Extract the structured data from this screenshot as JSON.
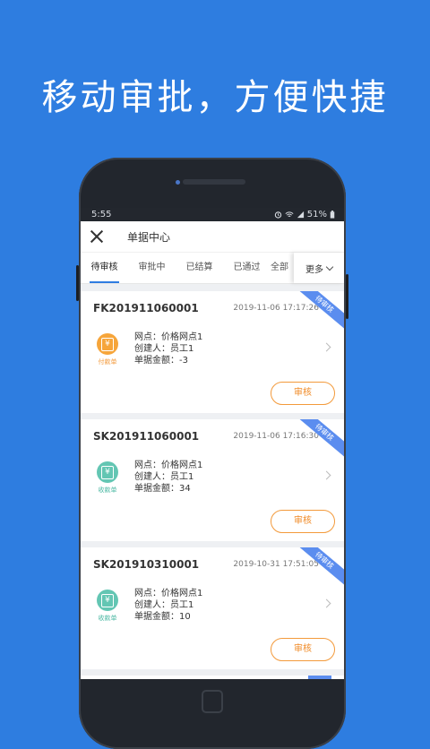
{
  "headline": "移动审批，方便快捷",
  "status_bar": {
    "time": "5:55",
    "battery": "51%",
    "icons": [
      "alarm-icon",
      "wifi-icon",
      "signal-icon",
      "battery-icon"
    ]
  },
  "nav": {
    "title": "单据中心",
    "close_icon": "close-icon"
  },
  "tabs": [
    {
      "label": "待审核",
      "active": true
    },
    {
      "label": "审批中",
      "active": false
    },
    {
      "label": "已结算",
      "active": false
    },
    {
      "label": "已通过",
      "active": false
    },
    {
      "label": "全部",
      "active": false
    }
  ],
  "more_label": "更多",
  "cards": [
    {
      "code": "FK201911060001",
      "time": "2019-11-06 17:17:26",
      "ribbon": "待审核",
      "type_label": "付款单",
      "type_color": "#f6a53a",
      "type_label_color": "#f39a3b",
      "outlet": "网点：价格网点1",
      "creator": "创建人：员工1",
      "amount": "单据金额：-3",
      "action": "审核"
    },
    {
      "code": "SK201911060001",
      "time": "2019-11-06 17:16:30",
      "ribbon": "待审核",
      "type_label": "收款单",
      "type_color": "#63c6b3",
      "type_label_color": "#4bb8a3",
      "outlet": "网点：价格网点1",
      "creator": "创建人：员工1",
      "amount": "单据金额：34",
      "action": "审核"
    },
    {
      "code": "SK201910310001",
      "time": "2019-10-31 17:51:05",
      "ribbon": "待审核",
      "type_label": "收款单",
      "type_color": "#63c6b3",
      "type_label_color": "#4bb8a3",
      "outlet": "网点：价格网点1",
      "creator": "创建人：员工1",
      "amount": "单据金额：10",
      "action": "审核"
    }
  ],
  "colors": {
    "background": "#2e7de0",
    "accent": "#2f7de1",
    "ribbon": "#5b8def",
    "action": "#f08a26"
  }
}
